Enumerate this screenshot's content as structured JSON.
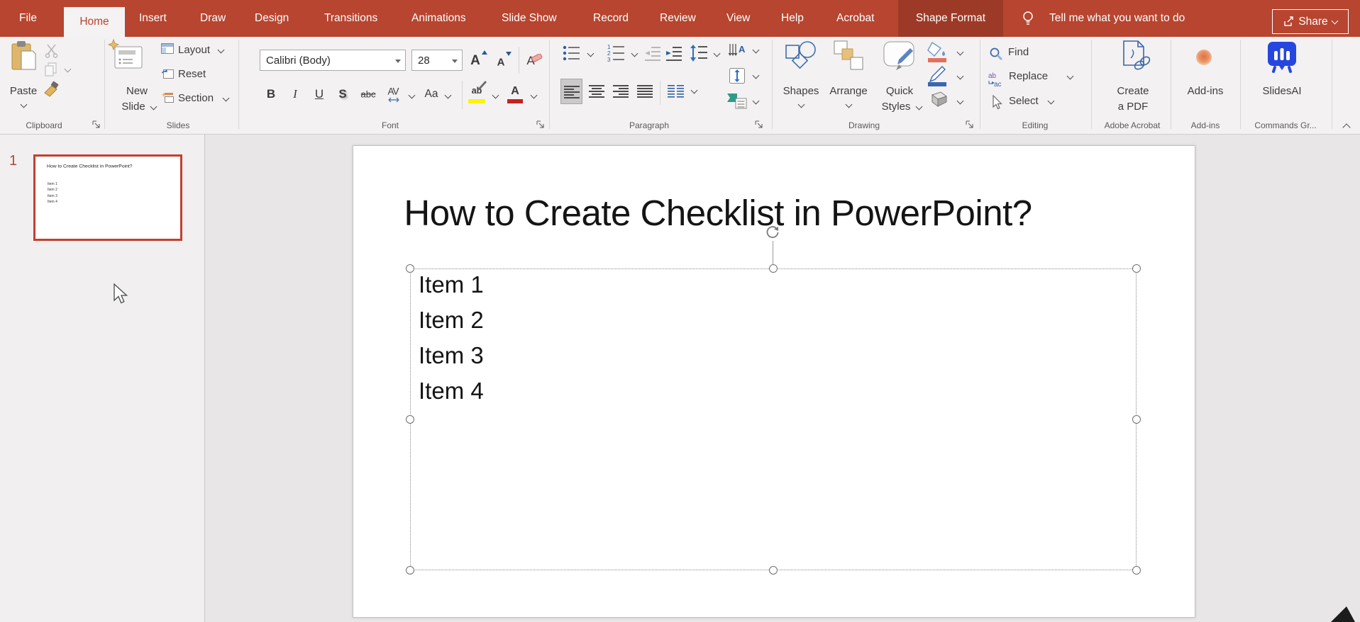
{
  "tab_bar": {
    "tabs": [
      "File",
      "Home",
      "Insert",
      "Draw",
      "Design",
      "Transitions",
      "Animations",
      "Slide Show",
      "Record",
      "Review",
      "View",
      "Help",
      "Acrobat",
      "Shape Format"
    ],
    "selected_tab": "Home",
    "tell_me": "Tell me what you want to do",
    "share_label": "Share"
  },
  "ribbon": {
    "clipboard": {
      "label": "Clipboard",
      "paste_label": "Paste"
    },
    "slides": {
      "label": "Slides",
      "new_slide_line1": "New",
      "new_slide_line2": "Slide",
      "layout_label": "Layout",
      "reset_label": "Reset",
      "section_label": "Section"
    },
    "font": {
      "label": "Font",
      "font_name": "Calibri (Body)",
      "font_size": "28",
      "bold": "B",
      "italic": "I",
      "underline": "U",
      "shadow": "S",
      "strikethrough": "abc",
      "char_spacing": "AV",
      "change_case": "Aa",
      "highlight_letters": "ab",
      "font_color_letter": "A",
      "grow_letter": "A",
      "shrink_letter": "A",
      "clear_letter": "A"
    },
    "paragraph": {
      "label": "Paragraph"
    },
    "drawing": {
      "label": "Drawing",
      "shapes_label": "Shapes",
      "arrange_label": "Arrange",
      "quick_styles_line1": "Quick",
      "quick_styles_line2": "Styles"
    },
    "editing": {
      "label": "Editing",
      "find_label": "Find",
      "replace_label": "Replace",
      "select_label": "Select"
    },
    "adobe": {
      "label": "Adobe Acrobat",
      "button_line1": "Create",
      "button_line2": "a PDF"
    },
    "addins": {
      "label": "Add-ins",
      "button_label": "Add-ins"
    },
    "commands": {
      "label": "Commands Gr...",
      "button_label": "SlidesAI"
    }
  },
  "slides_panel": {
    "slide_number": "1"
  },
  "slide": {
    "title": "How to Create Checklist in PowerPoint?",
    "items": [
      "Item 1",
      "Item 2",
      "Item 3",
      "Item 4"
    ]
  },
  "colors": {
    "accent_red": "#b7452f",
    "contextual_tab_bg": "#9d3a27",
    "ribbon_bg": "#f3f1f2",
    "panel_bg": "#f1eff0",
    "editor_bg": "#e8e6e7",
    "selected_thumb_red": "#c2402f",
    "highlight_yellow": "#fcf400",
    "font_color_red": "#c81f1f",
    "slidesai_blue": "#2546df",
    "addins_orange": "#e8956a"
  }
}
